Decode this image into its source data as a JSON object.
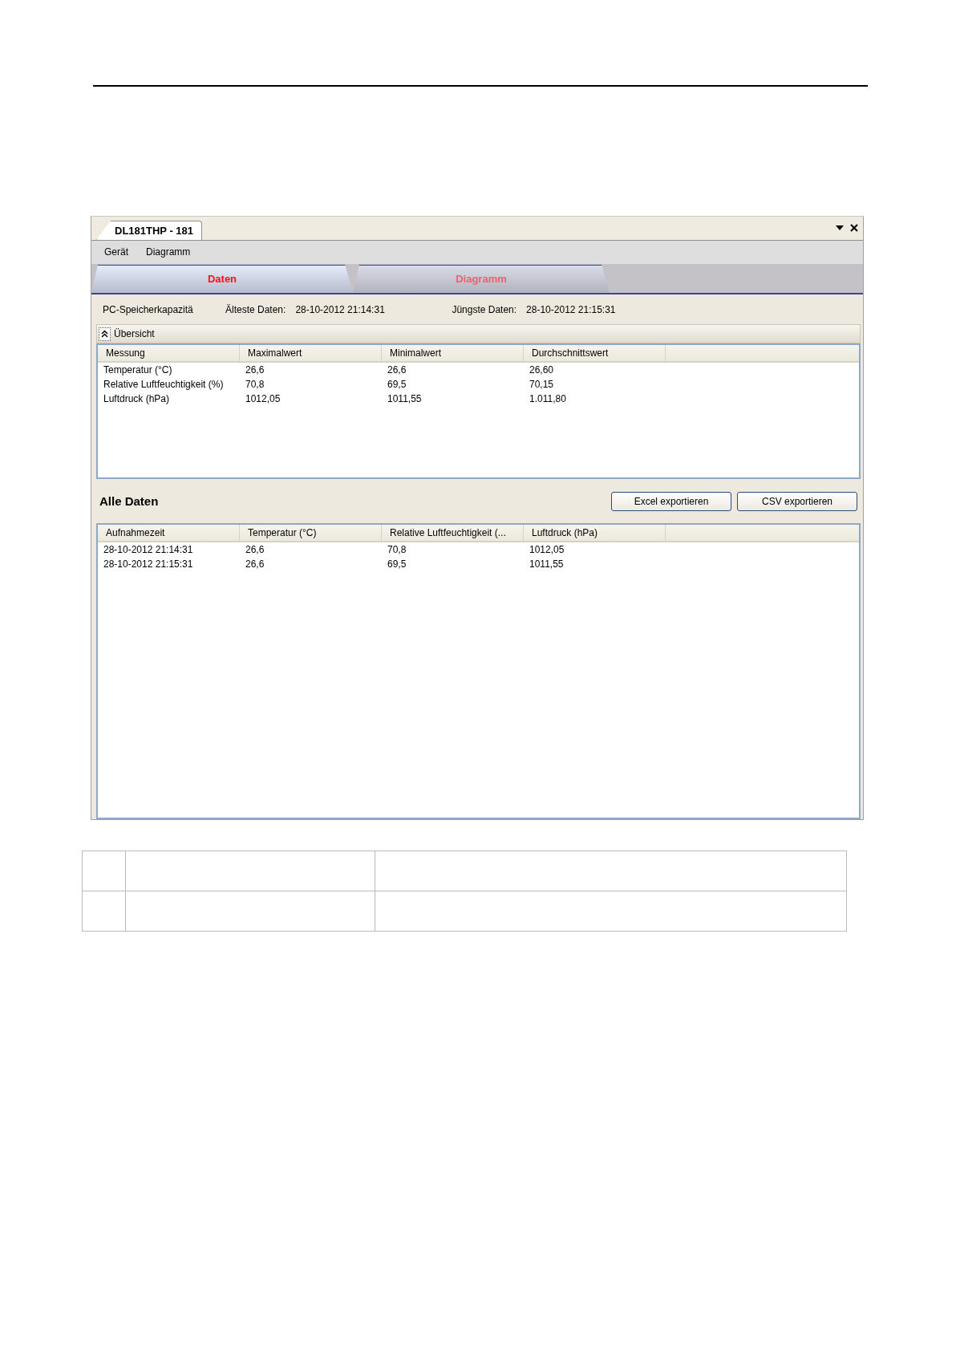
{
  "document_tab": {
    "title": "DL181THP - 181"
  },
  "menu": [
    "Gerät",
    "Diagramm"
  ],
  "tabs": [
    {
      "label": "Daten",
      "selected": true
    },
    {
      "label": "Diagramm",
      "selected": false
    }
  ],
  "info": [
    {
      "label": "PC-Speicherkapazitä"
    },
    {
      "label": "Älteste Daten:",
      "value": "28-10-2012 21:14:31"
    },
    {
      "label": "Jüngste Daten:",
      "value": "28-10-2012 21:15:31"
    }
  ],
  "overview": {
    "title": "Übersicht",
    "expanded": true,
    "columns": [
      "Messung",
      "Maximalwert",
      "Minimalwert",
      "Durchschnittswert"
    ],
    "rows": [
      [
        "Temperatur (°C)",
        "26,6",
        "26,6",
        "26,60"
      ],
      [
        "Relative Luftfeuchtigkeit (%)",
        "70,8",
        "69,5",
        "70,15"
      ],
      [
        "Luftdruck (hPa)",
        "1012,05",
        "1011,55",
        "1.011,80"
      ]
    ]
  },
  "all_data": {
    "title": "Alle Daten",
    "buttons": [
      "Excel exportieren",
      "CSV exportieren"
    ],
    "columns": [
      "Aufnahmezeit",
      "Temperatur (°C)",
      "Relative Luftfeuchtigkeit (...",
      "Luftdruck (hPa)"
    ],
    "rows": [
      [
        "28-10-2012 21:14:31",
        "26,6",
        "70,8",
        "1012,05"
      ],
      [
        "28-10-2012 21:15:31",
        "26,6",
        "69,5",
        "1011,55"
      ]
    ]
  }
}
